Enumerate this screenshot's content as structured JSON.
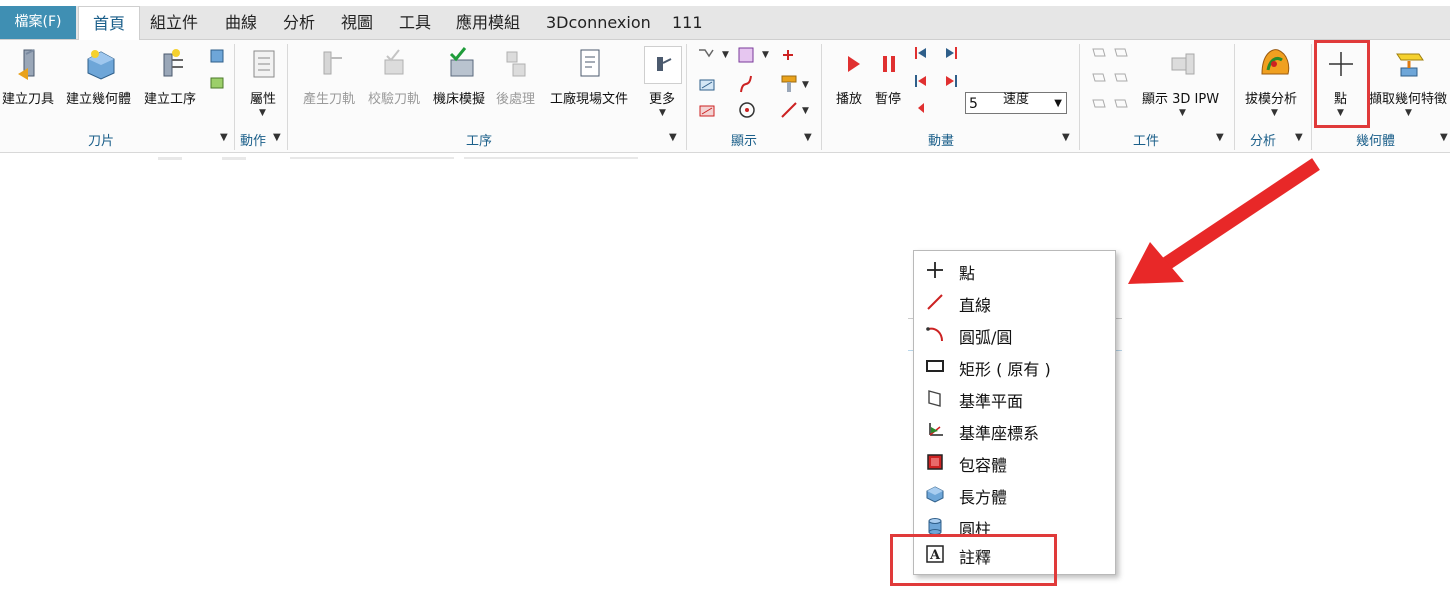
{
  "tabs": {
    "file": "檔案(F)",
    "items": [
      "首頁",
      "組立件",
      "曲線",
      "分析",
      "視圖",
      "工具",
      "應用模組",
      "3Dconnexion",
      "111"
    ],
    "active": "首頁"
  },
  "ribbon": {
    "buttons": {
      "create_tool": "建立刀具",
      "create_geometry": "建立幾何體",
      "create_operation": "建立工序",
      "properties": "屬性",
      "generate_toolpath": "產生刀軌",
      "verify_toolpath": "校驗刀軌",
      "machine_sim": "機床模擬",
      "postprocess": "後處理",
      "shop_doc": "工廠現場文件",
      "more": "更多",
      "play": "播放",
      "pause": "暫停",
      "speed": "速度",
      "show_3d_ipw": "顯示 3D IPW",
      "draft_analysis": "拔模分析",
      "point": "點",
      "extract_geometry": "擷取幾何特徵"
    },
    "speed_value": "5",
    "groups": {
      "blade": "刀片",
      "action": "動作",
      "operation": "工序",
      "display": "顯示",
      "animation": "動畫",
      "workpiece": "工件",
      "analysis": "分析",
      "geometry": "幾何體"
    }
  },
  "menu": {
    "items": [
      {
        "label": "點",
        "icon": "plus-icon"
      },
      {
        "label": "直線",
        "icon": "line-icon"
      },
      {
        "label": "圓弧/圓",
        "icon": "arc-icon"
      },
      {
        "label": "矩形 ( 原有 )",
        "icon": "rectangle-icon"
      },
      {
        "label": "基準平面",
        "icon": "datum-plane-icon"
      },
      {
        "label": "基準座標系",
        "icon": "datum-csys-icon"
      },
      {
        "label": "包容體",
        "icon": "bounding-body-icon"
      },
      {
        "label": "長方體",
        "icon": "block-icon"
      },
      {
        "label": "圓柱",
        "icon": "cylinder-icon"
      },
      {
        "label": "註釋",
        "icon": "annotation-icon"
      }
    ]
  },
  "colors": {
    "file_tab": "#3f8fb3",
    "accent_text": "#1b5f8a",
    "highlight": "#e03a3a"
  }
}
